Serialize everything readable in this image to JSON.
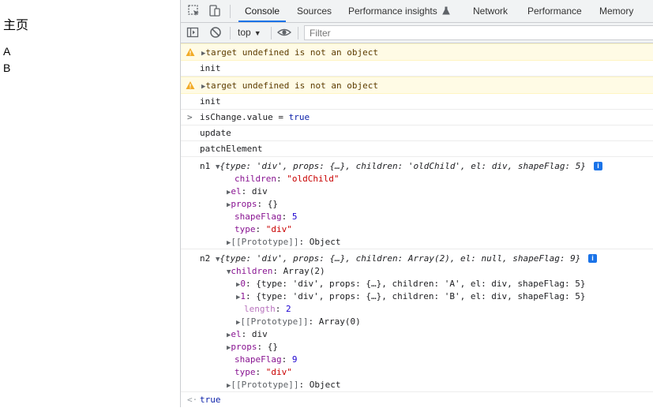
{
  "page": {
    "title": "主页",
    "items": [
      "A",
      "B"
    ]
  },
  "devtools": {
    "tabs": [
      "Console",
      "Sources",
      "Performance insights",
      "Network",
      "Performance",
      "Memory"
    ],
    "active_tab": "Console",
    "context": "top",
    "filter_placeholder": "Filter",
    "colors": {
      "accent": "#1a73e8",
      "warning_bg": "#fffbe5",
      "warning_text": "#5c3c00",
      "key": "#881391",
      "string": "#c80000",
      "number": "#1c00cf"
    }
  },
  "console": {
    "warn1": "target undefined is not an object",
    "log_init1": "init",
    "warn2": "target undefined is not an object",
    "log_init2": "init",
    "input_expr": "isChange.value = ",
    "input_val": "true",
    "log_update": "update",
    "log_patch": "patchElement",
    "n1": {
      "label": "n1",
      "summary": "{type: 'div', props: {…}, children: 'oldChild', el: div, shapeFlag: 5}",
      "props": [
        {
          "key": "children",
          "val": "\"oldChild\"",
          "kind": "string",
          "expandable": false
        },
        {
          "key": "el",
          "val": "div",
          "kind": "plain",
          "expandable": true
        },
        {
          "key": "props",
          "val": "{}",
          "kind": "plain",
          "expandable": true
        },
        {
          "key": "shapeFlag",
          "val": "5",
          "kind": "number",
          "expandable": false
        },
        {
          "key": "type",
          "val": "\"div\"",
          "kind": "string",
          "expandable": false
        },
        {
          "key": "[[Prototype]]",
          "val": "Object",
          "kind": "plain",
          "expandable": true,
          "dim": true
        }
      ]
    },
    "n2": {
      "label": "n2",
      "summary": "{type: 'div', props: {…}, children: Array(2), el: null, shapeFlag: 9}",
      "children_key": "children",
      "children_val": "Array(2)",
      "array_items": [
        {
          "key": "0",
          "val": "{type: 'div', props: {…}, children: 'A', el: div, shapeFlag: 5}"
        },
        {
          "key": "1",
          "val": "{type: 'div', props: {…}, children: 'B', el: div, shapeFlag: 5}"
        }
      ],
      "length_key": "length",
      "length_val": "2",
      "array_proto_key": "[[Prototype]]",
      "array_proto_val": "Array(0)",
      "rest": [
        {
          "key": "el",
          "val": "div",
          "kind": "plain",
          "expandable": true
        },
        {
          "key": "props",
          "val": "{}",
          "kind": "plain",
          "expandable": true
        },
        {
          "key": "shapeFlag",
          "val": "9",
          "kind": "number",
          "expandable": false
        },
        {
          "key": "type",
          "val": "\"div\"",
          "kind": "string",
          "expandable": false
        },
        {
          "key": "[[Prototype]]",
          "val": "Object",
          "kind": "plain",
          "expandable": true,
          "dim": true
        }
      ]
    },
    "result": "true"
  }
}
